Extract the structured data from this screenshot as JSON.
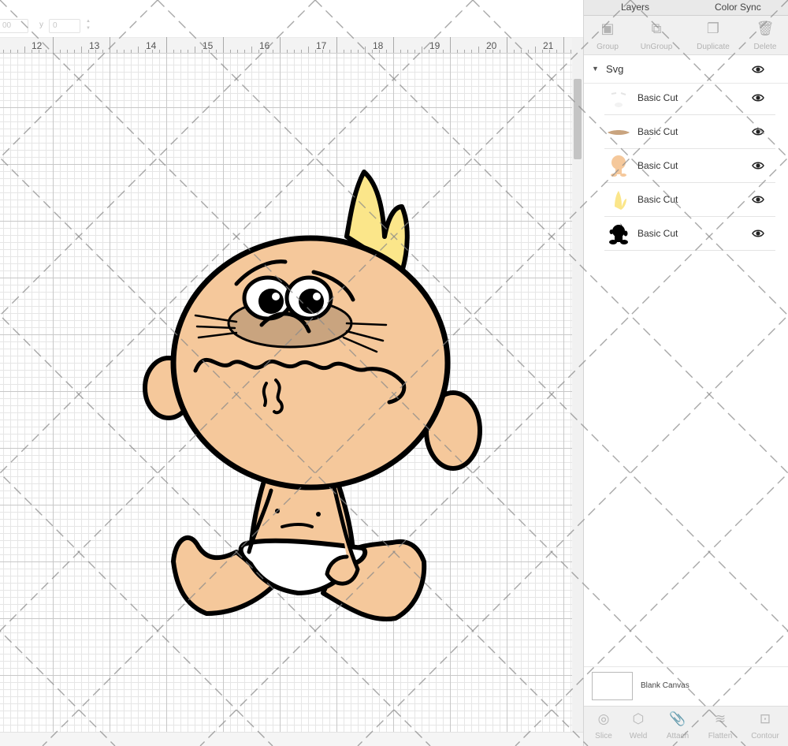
{
  "topbar": {
    "x_label": "",
    "x_value": "00",
    "y_label": "y",
    "y_value": "0"
  },
  "ruler": {
    "labels": [
      "12",
      "13",
      "14",
      "15",
      "16",
      "17",
      "18",
      "19",
      "20",
      "21"
    ]
  },
  "panel": {
    "tabs": [
      "Layers",
      "Color Sync"
    ],
    "tools": [
      {
        "label": "Group",
        "icon": "group-icon"
      },
      {
        "label": "UnGroup",
        "icon": "ungroup-icon"
      },
      {
        "label": "Duplicate",
        "icon": "duplicate-icon"
      },
      {
        "label": "Delete",
        "icon": "trash-icon"
      }
    ],
    "group_label": "Svg",
    "layers": [
      {
        "label": "Basic Cut",
        "thumb": "white-shapes"
      },
      {
        "label": "Basic Cut",
        "thumb": "brown-shapes"
      },
      {
        "label": "Basic Cut",
        "thumb": "skin-shapes"
      },
      {
        "label": "Basic Cut",
        "thumb": "yellow-hair"
      },
      {
        "label": "Basic Cut",
        "thumb": "black-outline"
      }
    ],
    "canvas_label": "Blank Canvas",
    "bottom_tools": [
      {
        "label": "Slice",
        "icon": "slice-icon"
      },
      {
        "label": "Weld",
        "icon": "weld-icon"
      },
      {
        "label": "Attach",
        "icon": "attach-icon"
      },
      {
        "label": "Flatten",
        "icon": "flatten-icon"
      },
      {
        "label": "Contour",
        "icon": "contour-icon"
      }
    ]
  },
  "colors": {
    "skin": "#f5c89b",
    "hair": "#fbe68a",
    "cheek_brown": "#c9a47f",
    "diaper": "#ffffff",
    "outline": "#000000"
  }
}
